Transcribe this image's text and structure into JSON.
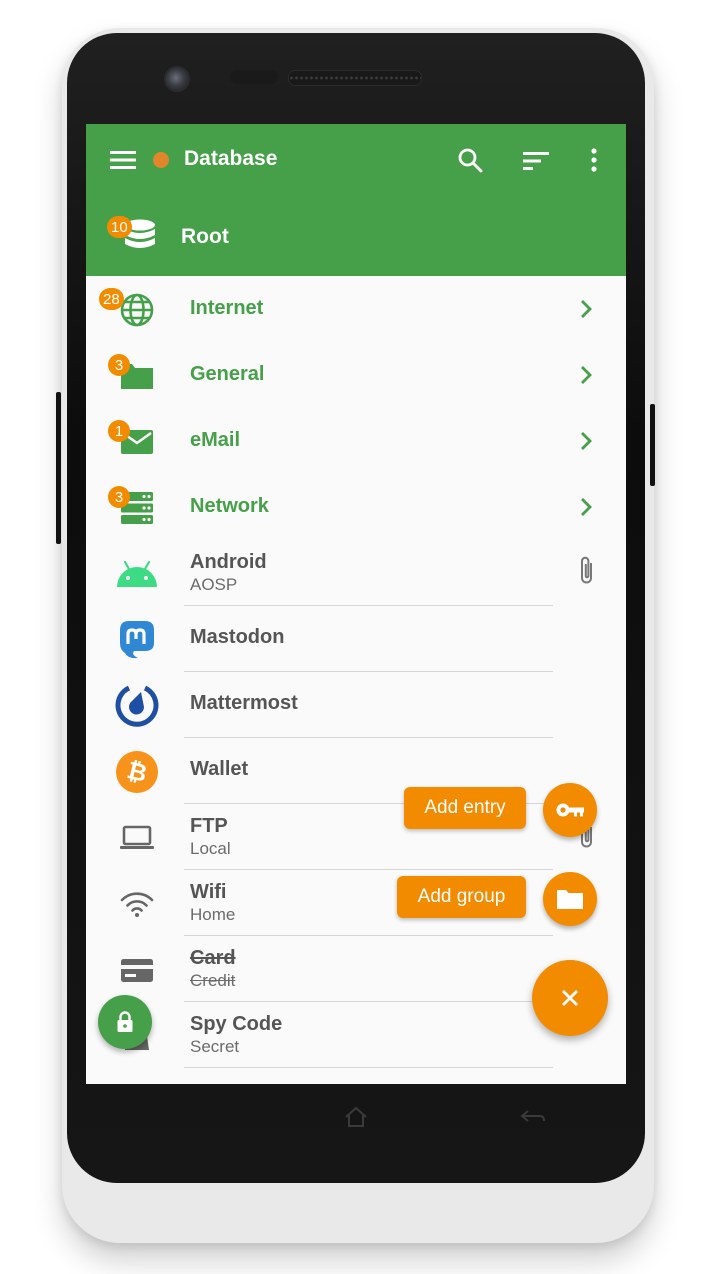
{
  "toolbar": {
    "title": "Database",
    "status_color": "#e1862a",
    "accent_color": "#45a049",
    "icons": [
      "menu-icon",
      "search-icon",
      "sort-icon",
      "more-vert-icon"
    ]
  },
  "root": {
    "label": "Root",
    "badge": "10",
    "icon": "database-icon"
  },
  "groups": [
    {
      "label": "Internet",
      "badge": "28",
      "icon": "globe-icon"
    },
    {
      "label": "General",
      "badge": "3",
      "icon": "folder-icon"
    },
    {
      "label": "eMail",
      "badge": "1",
      "icon": "mail-icon"
    },
    {
      "label": "Network",
      "badge": "3",
      "icon": "server-icon"
    }
  ],
  "entries": [
    {
      "title": "Android",
      "subtitle": "AOSP",
      "icon": "android-icon",
      "attachment": true
    },
    {
      "title": "Mastodon",
      "subtitle": "",
      "icon": "mastodon-icon"
    },
    {
      "title": "Mattermost",
      "subtitle": "",
      "icon": "mattermost-icon"
    },
    {
      "title": "Wallet",
      "subtitle": "",
      "icon": "bitcoin-icon"
    },
    {
      "title": "FTP",
      "subtitle": "Local",
      "icon": "laptop-icon",
      "attachment": true
    },
    {
      "title": "Wifi",
      "subtitle": "Home",
      "icon": "wifi-icon"
    },
    {
      "title": "Card",
      "subtitle": "Credit",
      "icon": "credit-card-icon",
      "expired": true
    },
    {
      "title": "Spy Code",
      "subtitle": "Secret",
      "icon": "spy-icon"
    }
  ],
  "fab": {
    "add_entry_label": "Add entry",
    "add_group_label": "Add group",
    "entry_icon": "key-icon",
    "group_icon": "folder-icon",
    "close_icon": "close-icon",
    "lock_icon": "lock-icon",
    "color": "#f28b00"
  },
  "navbar": {
    "icons": [
      "home-icon",
      "back-icon"
    ]
  }
}
